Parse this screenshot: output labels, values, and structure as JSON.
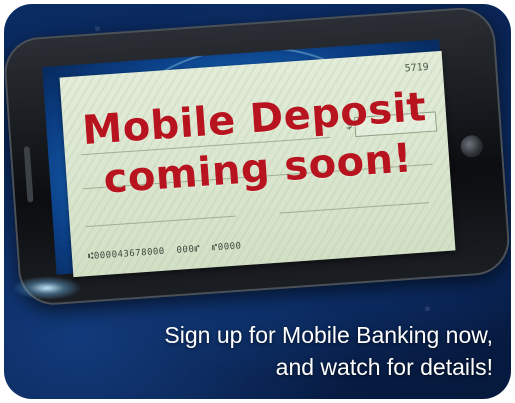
{
  "banner": {
    "headline_line1": "Mobile Deposit",
    "headline_line2": "coming soon!",
    "caption_line1": "Sign up for Mobile Banking now,",
    "caption_line2": "and watch for details!"
  },
  "check": {
    "number": "5719",
    "dollar_sign": "$",
    "micr_line": "⑆000043678000  000⑈  ⑈0000"
  },
  "colors": {
    "headline": "#b8141f",
    "background": "#0a2352",
    "check_paper": "#dde7d2",
    "caption_text": "#ffffff"
  }
}
